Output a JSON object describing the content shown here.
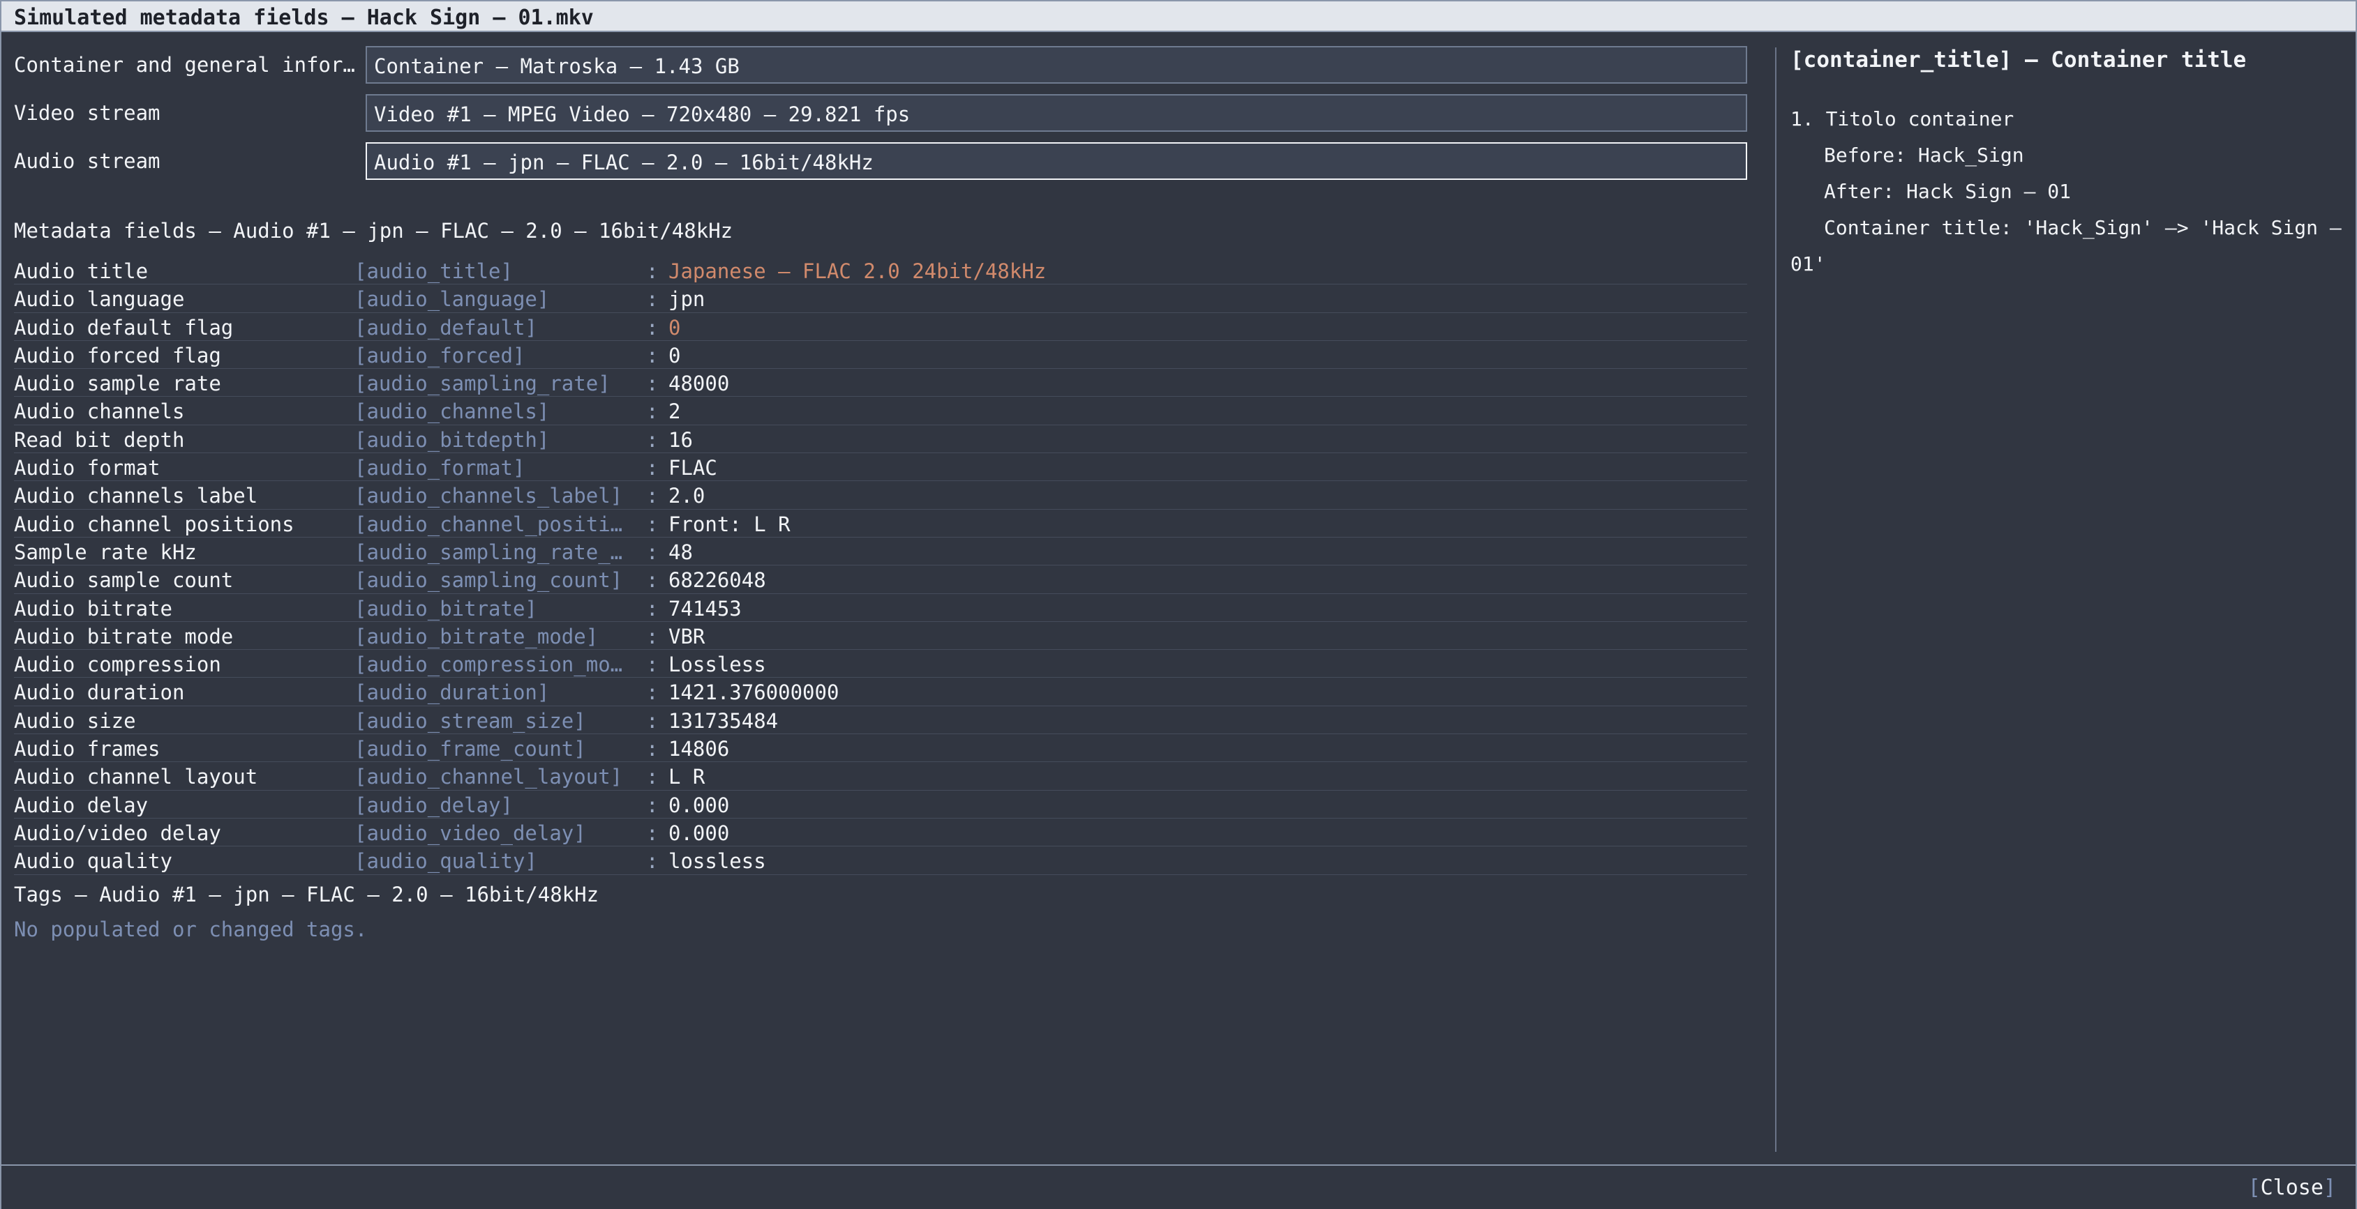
{
  "window": {
    "title": "Simulated metadata fields – Hack Sign – 01.mkv"
  },
  "selectors": [
    {
      "label": "Container and general infor…",
      "value": "Container – Matroska – 1.43 GB"
    },
    {
      "label": "Video stream",
      "value": "Video #1 – MPEG Video – 720x480 – 29.821 fps"
    },
    {
      "label": "Audio stream",
      "value": "Audio #1 – jpn – FLAC – 2.0 – 16bit/48kHz"
    }
  ],
  "metadata": {
    "heading": "Metadata fields – Audio #1 – jpn – FLAC – 2.0 – 16bit/48kHz",
    "separator": ":",
    "rows": [
      {
        "label": "Audio title",
        "key": "[audio_title]",
        "value": "Japanese – FLAC 2.0 24bit/48kHz",
        "changed": true
      },
      {
        "label": "Audio language",
        "key": "[audio_language]",
        "value": "jpn"
      },
      {
        "label": "Audio default flag",
        "key": "[audio_default]",
        "value": "0",
        "changed": true
      },
      {
        "label": "Audio forced flag",
        "key": "[audio_forced]",
        "value": "0"
      },
      {
        "label": "Audio sample rate",
        "key": "[audio_sampling_rate]",
        "value": "48000"
      },
      {
        "label": "Audio channels",
        "key": "[audio_channels]",
        "value": "2"
      },
      {
        "label": "Read bit depth",
        "key": "[audio_bitdepth]",
        "value": "16"
      },
      {
        "label": "Audio format",
        "key": "[audio_format]",
        "value": "FLAC"
      },
      {
        "label": "Audio channels label",
        "key": "[audio_channels_label]",
        "value": "2.0"
      },
      {
        "label": "Audio channel positions",
        "key": "[audio_channel_positio…",
        "value": "Front: L R"
      },
      {
        "label": "Sample rate kHz",
        "key": "[audio_sampling_rate_k…",
        "value": "48"
      },
      {
        "label": "Audio sample count",
        "key": "[audio_sampling_count]",
        "value": "68226048"
      },
      {
        "label": "Audio bitrate",
        "key": "[audio_bitrate]",
        "value": "741453"
      },
      {
        "label": "Audio bitrate mode",
        "key": "[audio_bitrate_mode]",
        "value": "VBR"
      },
      {
        "label": "Audio compression",
        "key": "[audio_compression_mod…",
        "value": "Lossless"
      },
      {
        "label": "Audio duration",
        "key": "[audio_duration]",
        "value": "1421.376000000"
      },
      {
        "label": "Audio size",
        "key": "[audio_stream_size]",
        "value": "131735484"
      },
      {
        "label": "Audio frames",
        "key": "[audio_frame_count]",
        "value": "14806"
      },
      {
        "label": "Audio channel layout",
        "key": "[audio_channel_layout]",
        "value": "L R"
      },
      {
        "label": "Audio delay",
        "key": "[audio_delay]",
        "value": "0.000"
      },
      {
        "label": "Audio/video delay",
        "key": "[audio_video_delay]",
        "value": "0.000"
      },
      {
        "label": "Audio quality",
        "key": "[audio_quality]",
        "value": "lossless"
      }
    ]
  },
  "tags": {
    "heading": "Tags – Audio #1 – jpn – FLAC – 2.0 – 16bit/48kHz",
    "empty_text": "No populated or changed tags."
  },
  "detail": {
    "heading": "[container_title] – Container title",
    "item_title": "1. Titolo container",
    "before": "Before: Hack_Sign",
    "after": "After: Hack Sign – 01",
    "change_line1": "Container title: 'Hack_Sign' –> 'Hack Sign –",
    "change_line2": "01'"
  },
  "buttons": {
    "close_open": "[",
    "close_label": "Close",
    "close_close": "]"
  },
  "colors": {
    "background": "#313641",
    "changed_value": "#d18a6c",
    "key_text": "#7d8fb3",
    "titlebar": "#e2e6ec"
  }
}
